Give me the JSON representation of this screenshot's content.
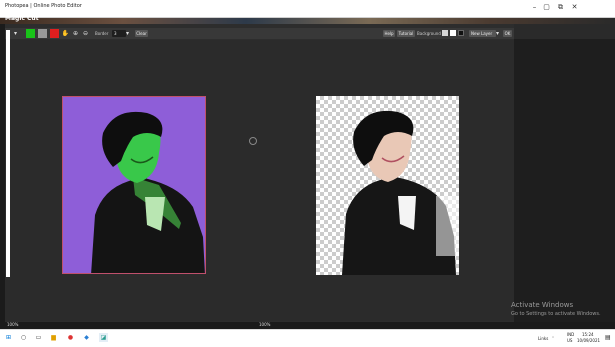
{
  "window": {
    "title": "Photopea | Online Photo Editor",
    "controls": [
      "–",
      "▢",
      "⧉",
      "✕"
    ]
  },
  "dialog": {
    "title": "Magic Cut",
    "border_label": "Border",
    "border_value": "3",
    "clear_label": "Clear",
    "help_label": "Help",
    "tutorial_label": "Tutorial",
    "background_label": "Background",
    "new_layer_label": "New Layer",
    "ok_label": "OK",
    "swatch_colors": [
      "#19c319",
      "#9a9a9a",
      "#e01f1f"
    ],
    "bg_colors": [
      "#d8d8d8",
      "#ffffff",
      "#111111"
    ]
  },
  "status": {
    "left_zoom": "100%",
    "right_zoom": "100%"
  },
  "activation": {
    "heading": "Activate Windows",
    "sub": "Go to Settings to activate Windows."
  },
  "taskbar": {
    "lang": "Links",
    "input_top": "IND",
    "input_bottom": "US",
    "time": "15:24",
    "date": "10/09/2021"
  }
}
